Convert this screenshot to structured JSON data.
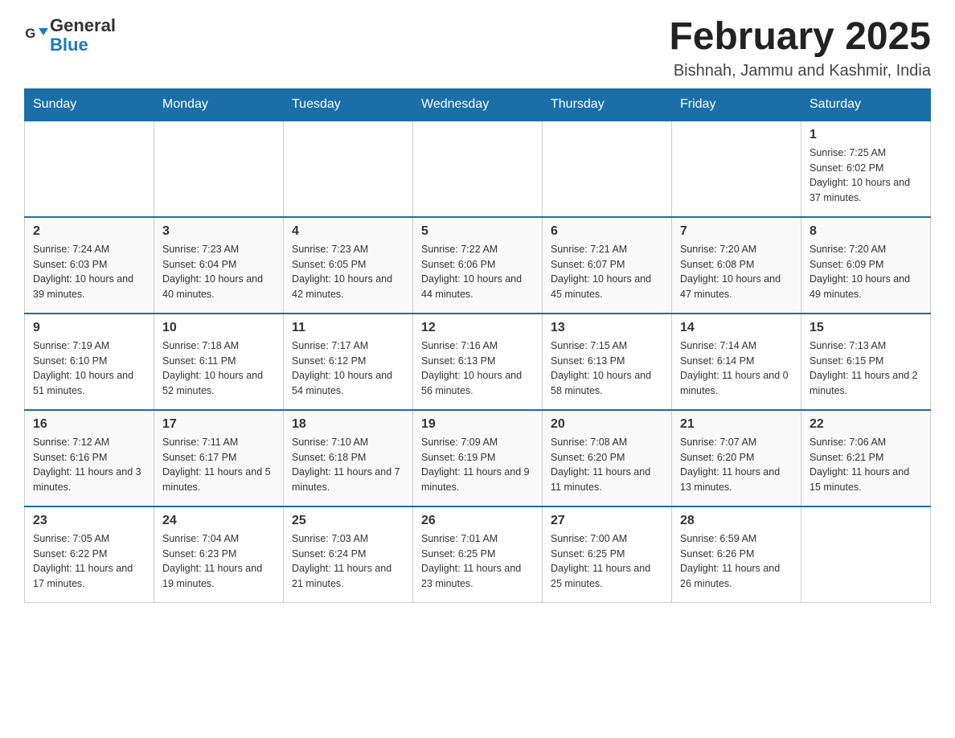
{
  "header": {
    "logo_general": "General",
    "logo_blue": "Blue",
    "title": "February 2025",
    "subtitle": "Bishnah, Jammu and Kashmir, India"
  },
  "weekdays": [
    "Sunday",
    "Monday",
    "Tuesday",
    "Wednesday",
    "Thursday",
    "Friday",
    "Saturday"
  ],
  "weeks": [
    [
      {
        "day": "",
        "info": ""
      },
      {
        "day": "",
        "info": ""
      },
      {
        "day": "",
        "info": ""
      },
      {
        "day": "",
        "info": ""
      },
      {
        "day": "",
        "info": ""
      },
      {
        "day": "",
        "info": ""
      },
      {
        "day": "1",
        "info": "Sunrise: 7:25 AM\nSunset: 6:02 PM\nDaylight: 10 hours and 37 minutes."
      }
    ],
    [
      {
        "day": "2",
        "info": "Sunrise: 7:24 AM\nSunset: 6:03 PM\nDaylight: 10 hours and 39 minutes."
      },
      {
        "day": "3",
        "info": "Sunrise: 7:23 AM\nSunset: 6:04 PM\nDaylight: 10 hours and 40 minutes."
      },
      {
        "day": "4",
        "info": "Sunrise: 7:23 AM\nSunset: 6:05 PM\nDaylight: 10 hours and 42 minutes."
      },
      {
        "day": "5",
        "info": "Sunrise: 7:22 AM\nSunset: 6:06 PM\nDaylight: 10 hours and 44 minutes."
      },
      {
        "day": "6",
        "info": "Sunrise: 7:21 AM\nSunset: 6:07 PM\nDaylight: 10 hours and 45 minutes."
      },
      {
        "day": "7",
        "info": "Sunrise: 7:20 AM\nSunset: 6:08 PM\nDaylight: 10 hours and 47 minutes."
      },
      {
        "day": "8",
        "info": "Sunrise: 7:20 AM\nSunset: 6:09 PM\nDaylight: 10 hours and 49 minutes."
      }
    ],
    [
      {
        "day": "9",
        "info": "Sunrise: 7:19 AM\nSunset: 6:10 PM\nDaylight: 10 hours and 51 minutes."
      },
      {
        "day": "10",
        "info": "Sunrise: 7:18 AM\nSunset: 6:11 PM\nDaylight: 10 hours and 52 minutes."
      },
      {
        "day": "11",
        "info": "Sunrise: 7:17 AM\nSunset: 6:12 PM\nDaylight: 10 hours and 54 minutes."
      },
      {
        "day": "12",
        "info": "Sunrise: 7:16 AM\nSunset: 6:13 PM\nDaylight: 10 hours and 56 minutes."
      },
      {
        "day": "13",
        "info": "Sunrise: 7:15 AM\nSunset: 6:13 PM\nDaylight: 10 hours and 58 minutes."
      },
      {
        "day": "14",
        "info": "Sunrise: 7:14 AM\nSunset: 6:14 PM\nDaylight: 11 hours and 0 minutes."
      },
      {
        "day": "15",
        "info": "Sunrise: 7:13 AM\nSunset: 6:15 PM\nDaylight: 11 hours and 2 minutes."
      }
    ],
    [
      {
        "day": "16",
        "info": "Sunrise: 7:12 AM\nSunset: 6:16 PM\nDaylight: 11 hours and 3 minutes."
      },
      {
        "day": "17",
        "info": "Sunrise: 7:11 AM\nSunset: 6:17 PM\nDaylight: 11 hours and 5 minutes."
      },
      {
        "day": "18",
        "info": "Sunrise: 7:10 AM\nSunset: 6:18 PM\nDaylight: 11 hours and 7 minutes."
      },
      {
        "day": "19",
        "info": "Sunrise: 7:09 AM\nSunset: 6:19 PM\nDaylight: 11 hours and 9 minutes."
      },
      {
        "day": "20",
        "info": "Sunrise: 7:08 AM\nSunset: 6:20 PM\nDaylight: 11 hours and 11 minutes."
      },
      {
        "day": "21",
        "info": "Sunrise: 7:07 AM\nSunset: 6:20 PM\nDaylight: 11 hours and 13 minutes."
      },
      {
        "day": "22",
        "info": "Sunrise: 7:06 AM\nSunset: 6:21 PM\nDaylight: 11 hours and 15 minutes."
      }
    ],
    [
      {
        "day": "23",
        "info": "Sunrise: 7:05 AM\nSunset: 6:22 PM\nDaylight: 11 hours and 17 minutes."
      },
      {
        "day": "24",
        "info": "Sunrise: 7:04 AM\nSunset: 6:23 PM\nDaylight: 11 hours and 19 minutes."
      },
      {
        "day": "25",
        "info": "Sunrise: 7:03 AM\nSunset: 6:24 PM\nDaylight: 11 hours and 21 minutes."
      },
      {
        "day": "26",
        "info": "Sunrise: 7:01 AM\nSunset: 6:25 PM\nDaylight: 11 hours and 23 minutes."
      },
      {
        "day": "27",
        "info": "Sunrise: 7:00 AM\nSunset: 6:25 PM\nDaylight: 11 hours and 25 minutes."
      },
      {
        "day": "28",
        "info": "Sunrise: 6:59 AM\nSunset: 6:26 PM\nDaylight: 11 hours and 26 minutes."
      },
      {
        "day": "",
        "info": ""
      }
    ]
  ]
}
